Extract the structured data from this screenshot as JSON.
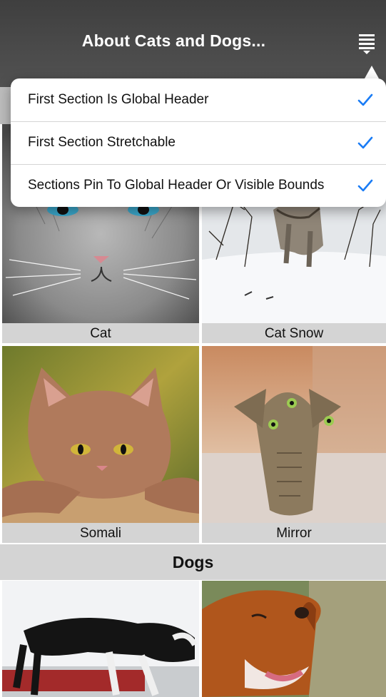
{
  "header": {
    "title": "About Cats and Dogs...",
    "menu_icon": "menu-icon"
  },
  "menu": {
    "items": [
      {
        "label": "First Section Is Global Header",
        "checked": true
      },
      {
        "label": "First Section Stretchable",
        "checked": true
      },
      {
        "label": "Sections Pin To Global Header Or Visible Bounds",
        "checked": true
      }
    ],
    "check_icon": "checkmark-icon",
    "accent_color": "#1a7cf5"
  },
  "cats": {
    "items": [
      {
        "caption": "Cat"
      },
      {
        "caption": "Cat Snow"
      },
      {
        "caption": "Somali"
      },
      {
        "caption": "Mirror"
      }
    ]
  },
  "dogs": {
    "section_title": "Dogs"
  }
}
